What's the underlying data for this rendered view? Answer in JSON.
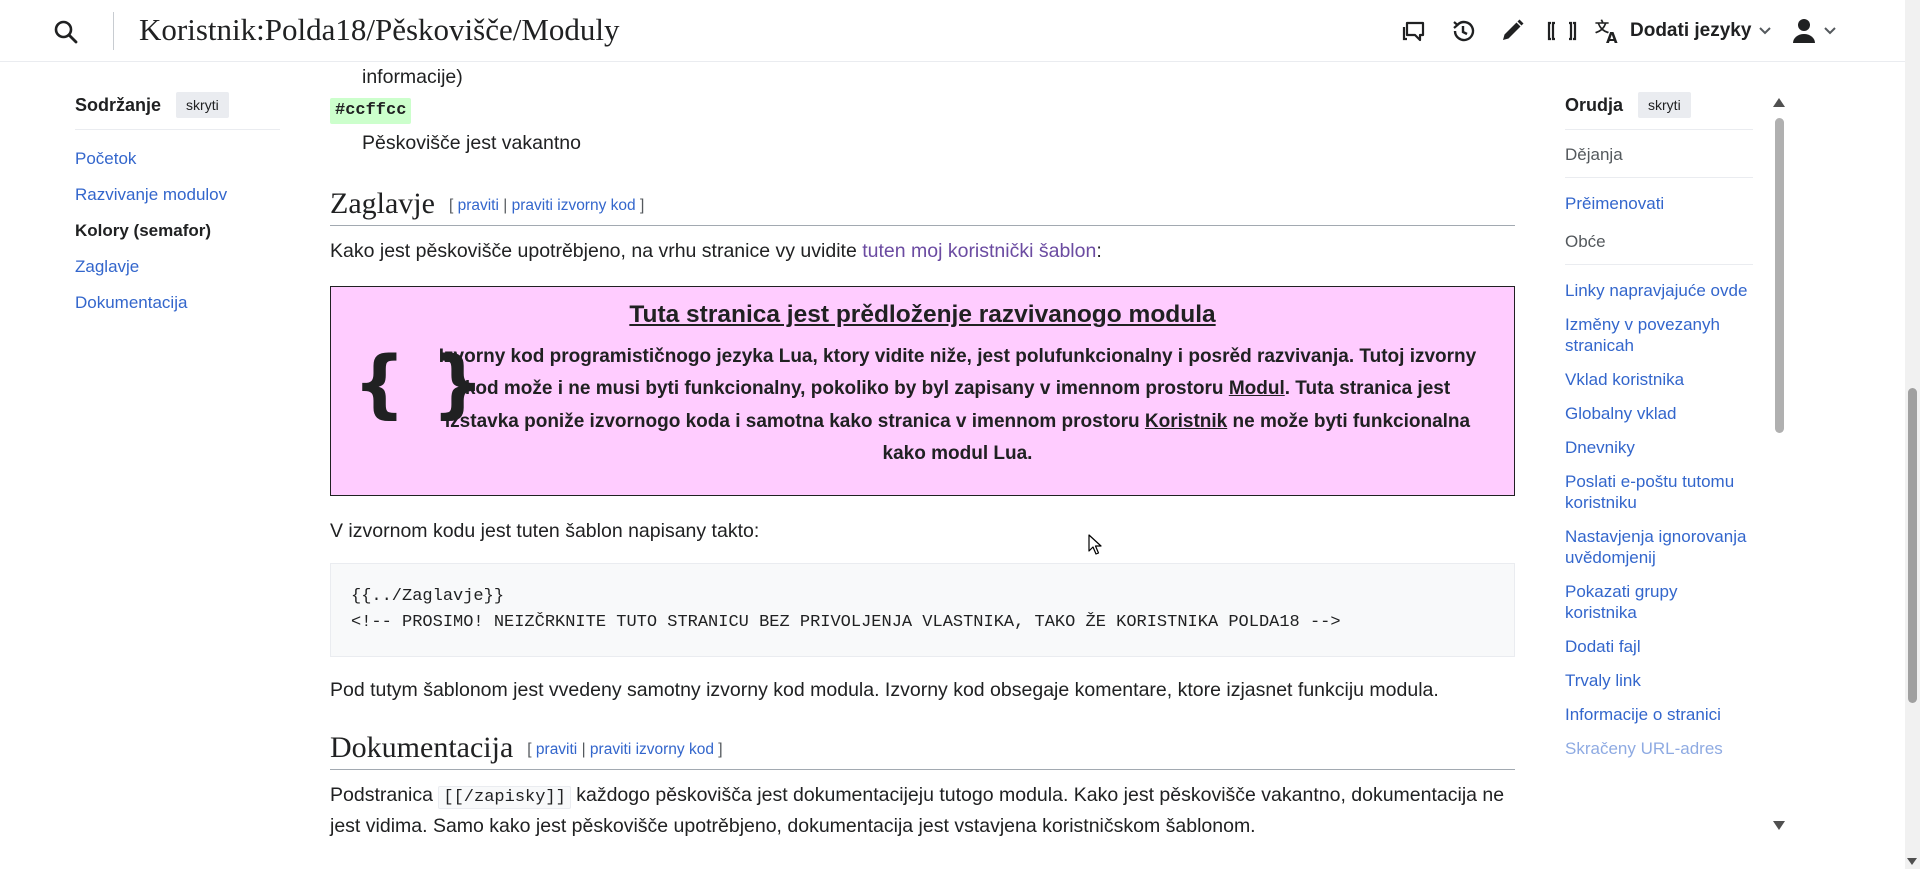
{
  "header": {
    "title": "Koristnik:Polda18/Pěskovišče/Moduly",
    "language_label": "Dodati jezyky",
    "icons": [
      "search-icon",
      "talk-icon",
      "history-icon",
      "edit-icon",
      "wikidata-icon",
      "language-icon",
      "user-icon",
      "chevron-down-icon"
    ]
  },
  "toc": {
    "heading": "Sodržanje",
    "hide_label": "skryti",
    "items": [
      {
        "label": "Početok"
      },
      {
        "label": "Razvivanje modulov"
      },
      {
        "label": "Kolory (semafor)"
      },
      {
        "label": "Zaglavje"
      },
      {
        "label": "Dokumentacija"
      }
    ]
  },
  "main": {
    "top_fragment": "informacije)",
    "swatch": "#ccffcc",
    "vacant_text": "Pěskovišče jest vakantno",
    "section1": {
      "title": "Zaglavje",
      "bracket_open": "[",
      "edit": "praviti",
      "sep": "|",
      "edit_source": "praviti izvorny kod",
      "bracket_close": "]"
    },
    "intro_before": "Kako jest pěskovišče upotrěbjeno, na vrhu stranice vy uvidite ",
    "intro_link": "tuten moj koristnički šablon",
    "intro_after": ":",
    "ambox": {
      "heading": "Tuta stranica jest prědloženje razvivanogo modula",
      "brace": "{ }",
      "text1": "Izvorny kod programističnogo jezyka Lua, ktory vidite niže, jest polufunkcionalny i posrěd razvivanja. Tutoj izvorny kod može i ne musi byti funkcionalny, pokoliko by byl zapisany v imennom prostoru ",
      "link1": "Modul",
      "text2": ". Tuta stranica jest izstavka poniže izvornogo koda i samotna kako stranica v imennom prostoru ",
      "link2": "Koristnik",
      "text3": " ne može byti funkcionalna kako modul Lua."
    },
    "source_intro": "V izvornom kodu jest tuten šablon napisany takto:",
    "code_line1": "{{../Zaglavje}}",
    "code_line2": "<!-- PROSIMO! NEIZČRKNITE TUTO STRANICU BEZ PRIVOLJENJA VLASTNIKA, TAKO ŽE KORISTNIKA POLDA18 -->",
    "after_code": "Pod tutym šablonom jest vvedeny samotny izvorny kod modula. Izvorny kod obsegaje komentare, ktore izjasnet funkciju modula.",
    "section2": {
      "title": "Dokumentacija",
      "bracket_open": "[",
      "edit": "praviti",
      "sep": "|",
      "edit_source": "praviti izvorny kod",
      "bracket_close": "]"
    },
    "doc_before": "Podstranica ",
    "doc_code": "[[/zapisky]]",
    "doc_after": " každogo pěskovišča jest dokumentacijeju tutogo modula. Kako jest pěskovišče vakantno, dokumentacija ne jest vidima. Samo kako jest pěskovišče upotrěbjeno, dokumentacija jest vstavjena koristničskom šablonom."
  },
  "tools": {
    "heading": "Orudja",
    "hide_label": "skryti",
    "actions_label": "Dějanja",
    "actions": [
      {
        "label": "Prěimenovati"
      }
    ],
    "general_label": "Obće",
    "general": [
      {
        "label": "Linky napravjajuće ovde"
      },
      {
        "label": "Izměny v povezanyh stranicah"
      },
      {
        "label": "Vklad koristnika"
      },
      {
        "label": "Globalny vklad"
      },
      {
        "label": "Dnevniky"
      },
      {
        "label": "Poslati e-poštu tutomu koristniku"
      },
      {
        "label": "Nastavjenja ignorovanja uvědomjenij"
      },
      {
        "label": "Pokazati grupy koristnika"
      },
      {
        "label": "Dodati fajl"
      },
      {
        "label": "Trvaly link"
      },
      {
        "label": "Informacije o stranici"
      },
      {
        "label": "Skračeny URL-adres"
      }
    ]
  },
  "colors": {
    "link": "#3366cc",
    "visited_link": "#6b4ba1",
    "ambox_bg": "#ffccff",
    "swatch_bg": "#ccffcc"
  }
}
